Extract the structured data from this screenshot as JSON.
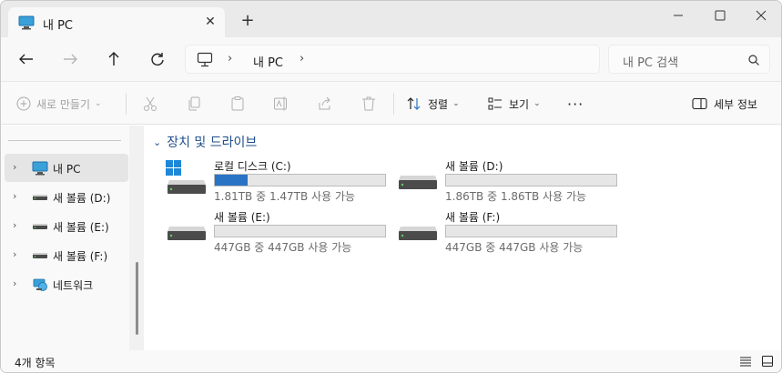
{
  "tab": {
    "title": "내 PC",
    "close_glyph": "✕",
    "new_glyph": "+",
    "icon": "pc-icon"
  },
  "address": {
    "location": "내 PC",
    "chevron": "›"
  },
  "search": {
    "placeholder": "내 PC 검색"
  },
  "commands": {
    "new_label": "새로 만들기",
    "sort_label": "정렬",
    "view_label": "보기",
    "more_glyph": "···",
    "details_label": "세부 정보"
  },
  "sidebar": {
    "items": [
      {
        "label": "내 PC",
        "icon": "pc-icon"
      },
      {
        "label": "새 볼륨 (D:)",
        "icon": "drive-icon"
      },
      {
        "label": "새 볼륨 (E:)",
        "icon": "drive-icon"
      },
      {
        "label": "새 볼륨 (F:)",
        "icon": "drive-icon"
      },
      {
        "label": "네트워크",
        "icon": "network-icon"
      }
    ]
  },
  "group": {
    "title": "장치 및 드라이브"
  },
  "drives": [
    {
      "name": "로컬 디스크 (C:)",
      "space": "1.81TB 중 1.47TB 사용 가능",
      "used_fraction": 0.19,
      "windows_logo": true
    },
    {
      "name": "새 볼륨 (D:)",
      "space": "1.86TB 중 1.86TB 사용 가능",
      "used_fraction": 0.0
    },
    {
      "name": "새 볼륨 (E:)",
      "space": "447GB 중 447GB 사용 가능",
      "used_fraction": 0.0
    },
    {
      "name": "새 볼륨 (F:)",
      "space": "447GB 중 447GB 사용 가능",
      "used_fraction": 0.0
    }
  ],
  "status": {
    "count": "4개 항목"
  },
  "colors": {
    "accent": "#2a74c6",
    "group_title": "#1f4e8c",
    "selected": "#e5e5e5"
  }
}
